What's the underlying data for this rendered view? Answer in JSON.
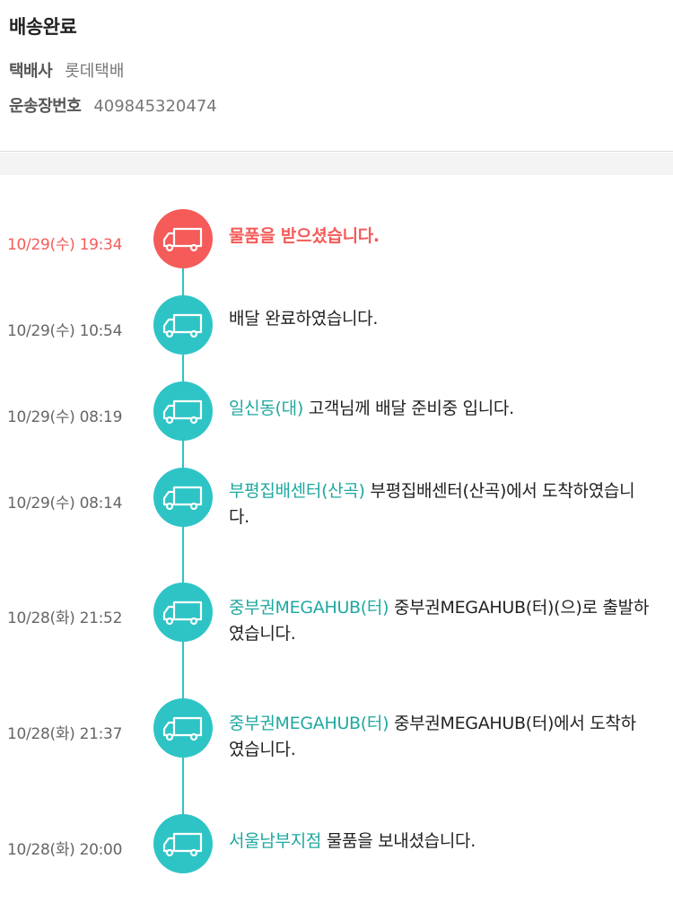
{
  "header": {
    "status": "배송완료",
    "courier_label": "택배사",
    "courier_value": "롯데택배",
    "tracking_label": "운송장번호",
    "tracking_value": "409845320474"
  },
  "colors": {
    "accent_teal": "#2ec4c6",
    "location_text": "#1fa8a0",
    "latest_red": "#f45b59"
  },
  "events": [
    {
      "time": "10/29(수) 19:34",
      "location": "",
      "message": "물품을 받으셨습니다.",
      "icon": "delivery-truck-icon"
    },
    {
      "time": "10/29(수) 10:54",
      "location": "",
      "message": "배달 완료하였습니다.",
      "icon": "delivery-truck-icon"
    },
    {
      "time": "10/29(수) 08:19",
      "location": "일신동(대)",
      "message": " 고객님께 배달 준비중 입니다.",
      "icon": "delivery-truck-icon"
    },
    {
      "time": "10/29(수) 08:14",
      "location": "부평집배센터(산곡)",
      "message": " 부평집배센터(산곡)에서 도착하였습니다.",
      "icon": "delivery-truck-icon"
    },
    {
      "time": "10/28(화) 21:52",
      "location": "중부권MEGAHUB(터)",
      "message": " 중부권MEGAHUB(터)(으)로 출발하였습니다.",
      "icon": "delivery-truck-icon"
    },
    {
      "time": "10/28(화) 21:37",
      "location": "중부권MEGAHUB(터)",
      "message": " 중부권MEGAHUB(터)에서 도착하였습니다.",
      "icon": "delivery-truck-icon"
    },
    {
      "time": "10/28(화) 20:00",
      "location": "서울남부지점",
      "message": " 물품을 보내셨습니다.",
      "icon": "delivery-truck-icon"
    }
  ]
}
